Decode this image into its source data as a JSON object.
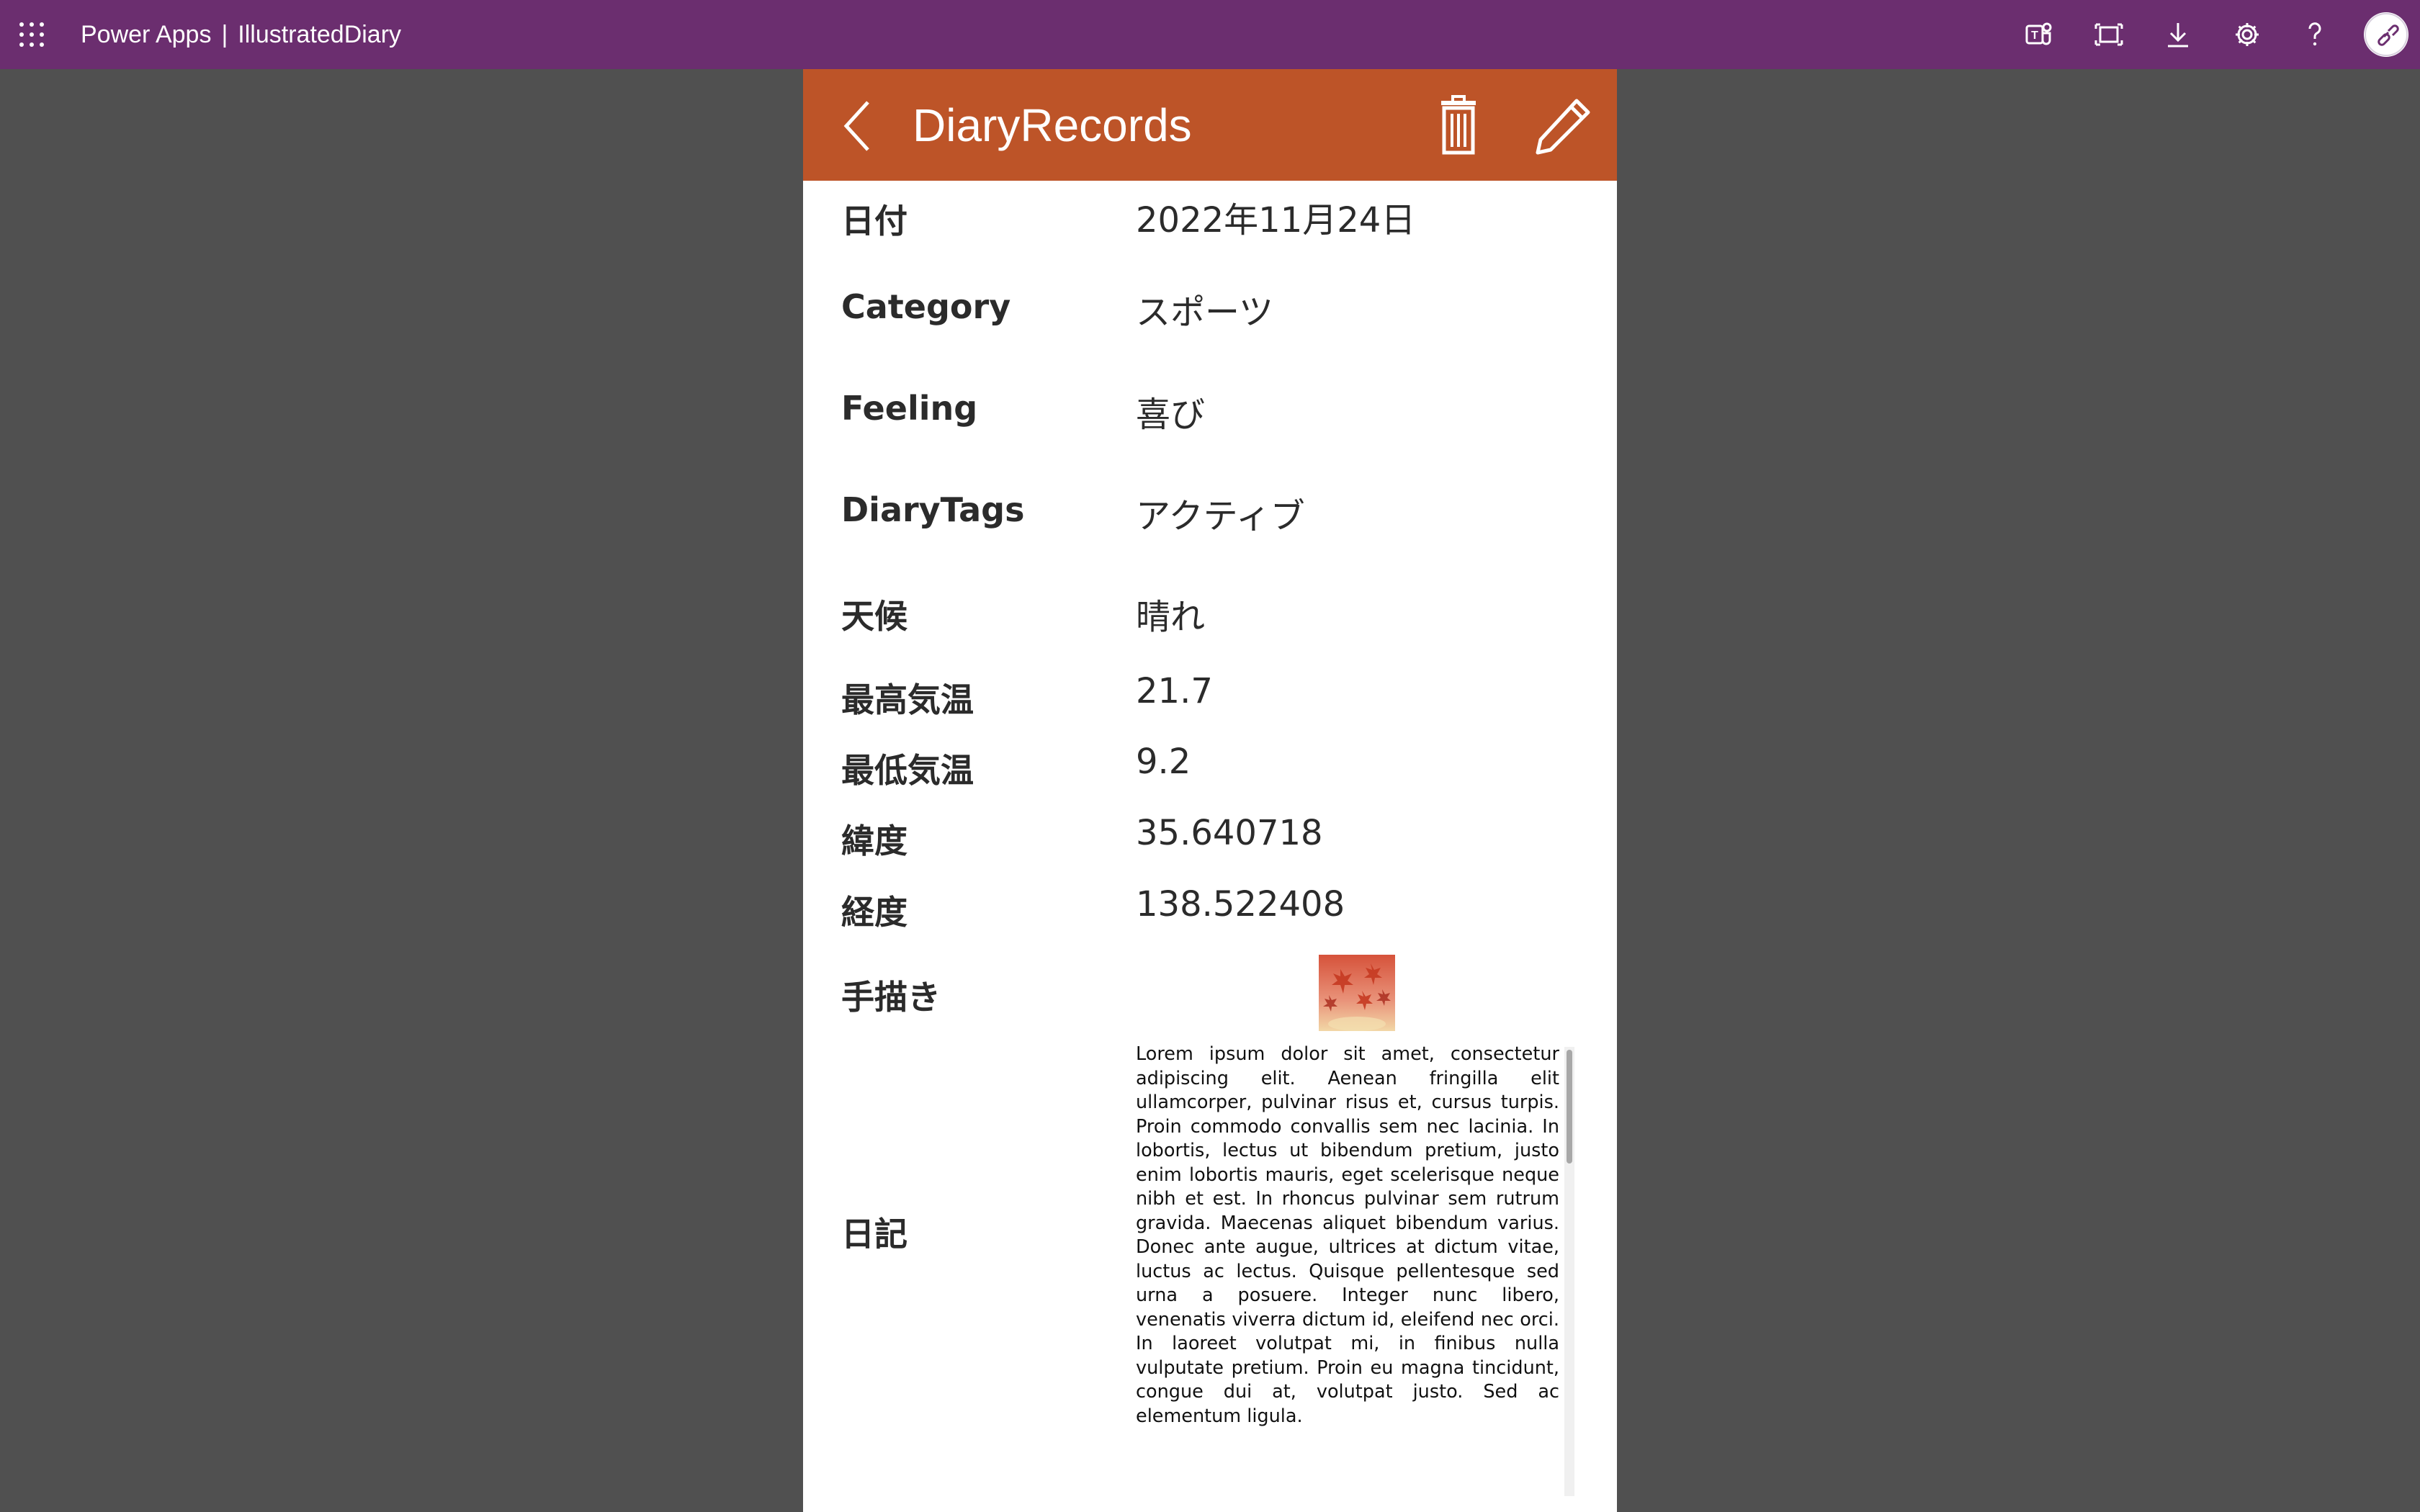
{
  "topbar": {
    "product": "Power Apps",
    "separator": "|",
    "app_name": "IllustratedDiary",
    "icons": [
      "waffle-icon",
      "teams-icon",
      "fit-screen-icon",
      "download-icon",
      "settings-icon",
      "help-icon",
      "avatar"
    ]
  },
  "header": {
    "title": "DiaryRecords",
    "icons": [
      "back-icon",
      "trash-icon",
      "pencil-icon"
    ]
  },
  "fields": [
    {
      "label": "日付",
      "value": "2022年11月24日"
    },
    {
      "label": "Category",
      "value": "スポーツ"
    },
    {
      "label": "Feeling",
      "value": "喜び"
    },
    {
      "label": "DiaryTags",
      "value": "アクティブ"
    },
    {
      "label": "天候",
      "value": "晴れ"
    },
    {
      "label": "最高気温",
      "value": "21.7"
    },
    {
      "label": "最低気温",
      "value": "9.2"
    },
    {
      "label": "緯度",
      "value": "35.640718"
    },
    {
      "label": "経度",
      "value": "138.522408"
    },
    {
      "label": "手描き",
      "value": ""
    },
    {
      "label": "日記",
      "value": "Lorem ipsum dolor sit amet, consectetur adipiscing elit. Aenean fringilla elit ullamcorper, pulvinar risus et, cursus turpis. Proin commodo convallis sem nec lacinia. In lobortis, lectus ut bibendum pretium, justo enim lobortis mauris, eget scelerisque neque nibh et est. In rhoncus pulvinar sem rutrum gravida. Maecenas aliquet bibendum varius. Donec ante augue, ultrices at dictum vitae, luctus ac lectus. Quisque pellentesque sed urna a posuere. Integer nunc libero, venenatis viverra dictum id, eleifend nec orci. In laoreet volutpat mi, in finibus nulla vulputate pretium. Proin eu magna tincidunt, congue dui at, volutpat justo. Sed ac elementum ligula."
    }
  ],
  "colors": {
    "topbar": "#6b2e6f",
    "header": "#bd5428",
    "page_background": "#505050",
    "canvas": "#ffffff"
  }
}
